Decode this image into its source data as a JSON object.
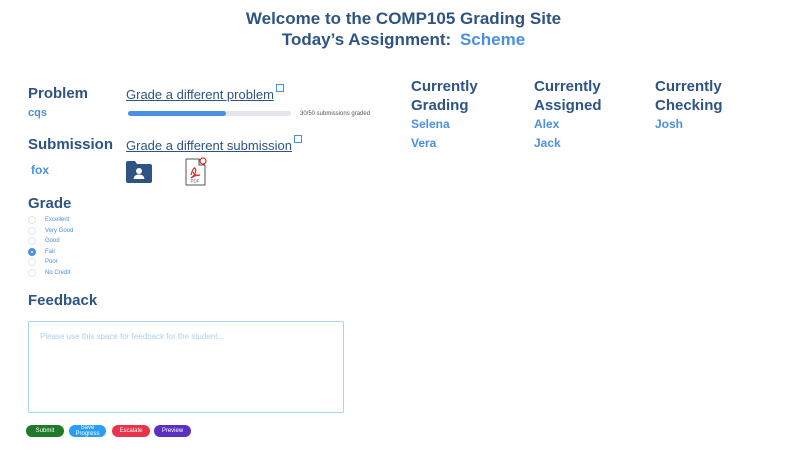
{
  "header": {
    "welcome": "Welcome to the COMP105 Grading Site",
    "assignment_label": "Today’s Assignment:",
    "assignment_name": "Scheme"
  },
  "problem": {
    "label": "Problem",
    "value": "cqs",
    "change_link": "Grade a different problem",
    "progress_text": "30/50 submissions graded",
    "progress_fraction": 0.6
  },
  "submission": {
    "label": "Submission",
    "value": "fox",
    "change_link": "Grade a different submission",
    "pdf_label": "PDF"
  },
  "grade": {
    "label": "Grade",
    "options": [
      "Excellent",
      "Very Good",
      "Good",
      "Fair",
      "Poor",
      "No Credit"
    ],
    "selected": "Fair"
  },
  "feedback": {
    "label": "Feedback",
    "placeholder": "Please use this space for feedback for the student..."
  },
  "buttons": {
    "submit": "Submit",
    "save_line1": "Save",
    "save_line2": "Progress",
    "escalate": "Escalate",
    "preview": "Preview"
  },
  "status_columns": {
    "grading": {
      "line1": "Currently",
      "line2": "Grading",
      "names": [
        "Selena",
        "Vera"
      ]
    },
    "assigned": {
      "line1": "Currently",
      "line2": "Assigned",
      "names": [
        "Alex",
        "Jack"
      ]
    },
    "checking": {
      "line1": "Currently",
      "line2": "Checking",
      "names": [
        "Josh"
      ]
    }
  },
  "colors": {
    "heading": "#2d5483",
    "accent": "#4a90e2",
    "submit": "#1f7a2a",
    "save": "#2a9df4",
    "escalate": "#e8334a",
    "preview": "#5b2fc0"
  }
}
